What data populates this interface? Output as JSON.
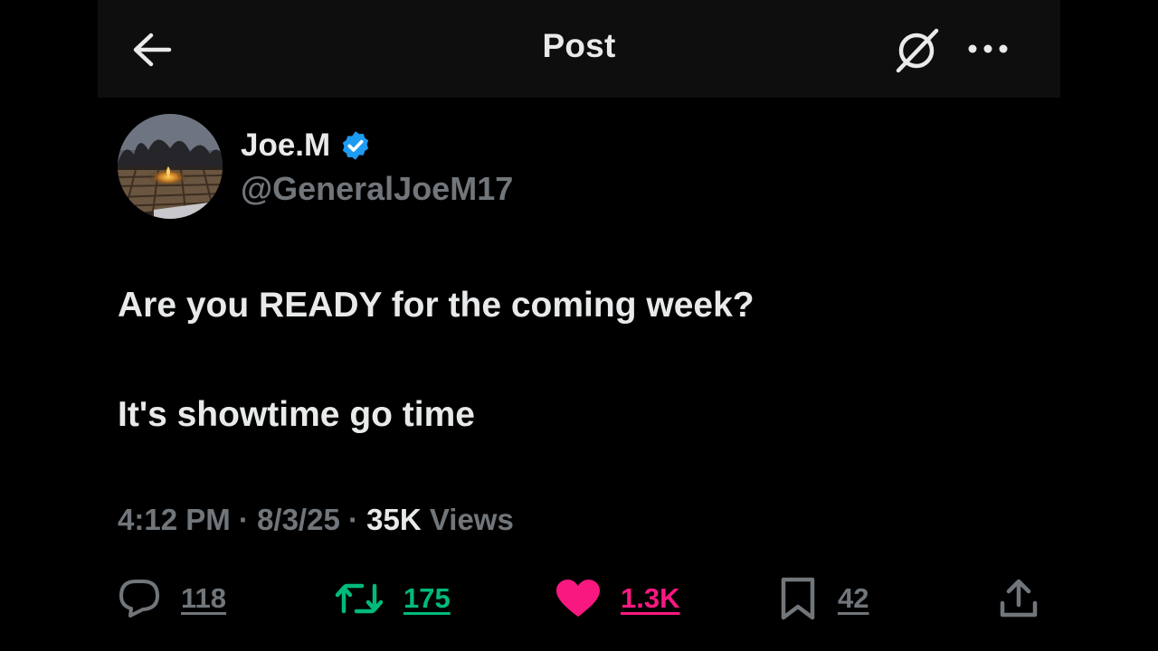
{
  "header": {
    "title": "Post",
    "back_icon": "arrow-left-icon",
    "grok_icon": "grok-icon",
    "more_icon": "more-dots-icon"
  },
  "author": {
    "display_name": "Joe.M",
    "handle": "@GeneralJoeM17",
    "verified": true,
    "verified_color": "#1d9bf0"
  },
  "tweet": {
    "lines": [
      "Are you READY for the coming week?",
      "It's showtime go time"
    ]
  },
  "meta": {
    "time": "4:12 PM",
    "separator": "·",
    "date": "8/3/25",
    "views_count": "35K",
    "views_label": "Views"
  },
  "actions": {
    "reply": {
      "count": "118",
      "icon": "reply-icon",
      "color": "#71767b"
    },
    "repost": {
      "count": "175",
      "icon": "repost-icon",
      "color": "#00ba7c"
    },
    "like": {
      "count": "1.3K",
      "icon": "heart-icon",
      "color": "#f91880"
    },
    "bookmark": {
      "count": "42",
      "icon": "bookmark-icon",
      "color": "#71767b"
    },
    "share": {
      "icon": "share-icon"
    }
  }
}
